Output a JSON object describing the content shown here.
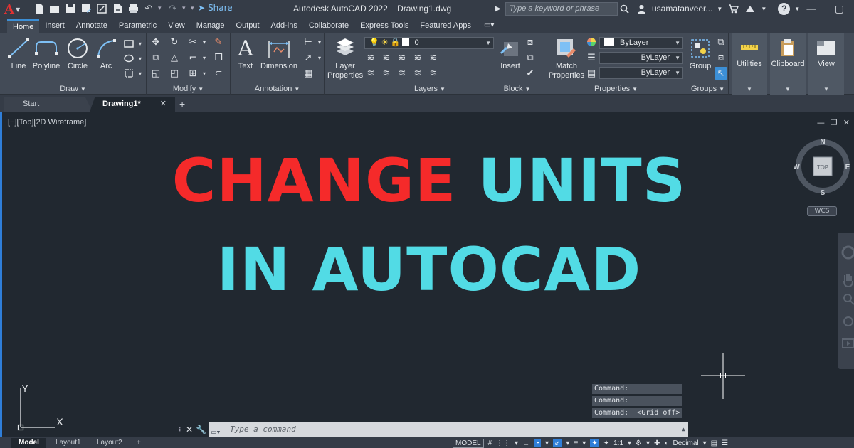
{
  "titlebar": {
    "app_icon": "A",
    "share_label": "Share",
    "title": "Autodesk AutoCAD 2022    Drawing1.dwg",
    "search_placeholder": "Type a keyword or phrase",
    "username": "usamatanveer...",
    "help_label": "?"
  },
  "ribbon_tabs": [
    {
      "label": "Home",
      "active": true
    },
    {
      "label": "Insert"
    },
    {
      "label": "Annotate"
    },
    {
      "label": "Parametric"
    },
    {
      "label": "View"
    },
    {
      "label": "Manage"
    },
    {
      "label": "Output"
    },
    {
      "label": "Add-ins"
    },
    {
      "label": "Collaborate"
    },
    {
      "label": "Express Tools"
    },
    {
      "label": "Featured Apps"
    }
  ],
  "ribbon": {
    "draw": {
      "title": "Draw",
      "line": "Line",
      "polyline": "Polyline",
      "circle": "Circle",
      "arc": "Arc"
    },
    "modify": {
      "title": "Modify"
    },
    "annotation": {
      "title": "Annotation",
      "text": "Text",
      "dimension": "Dimension"
    },
    "layers": {
      "title": "Layers",
      "layer_properties": "Layer\nProperties",
      "current_layer": "0"
    },
    "block": {
      "title": "Block",
      "insert": "Insert"
    },
    "properties": {
      "title": "Properties",
      "match": "Match\nProperties",
      "color": "ByLayer",
      "linetype": "ByLayer",
      "lineweight": "ByLayer"
    },
    "groups": {
      "title": "Groups",
      "group": "Group"
    },
    "utilities": "Utilities",
    "clipboard": "Clipboard",
    "view": "View"
  },
  "file_tabs": {
    "start": "Start",
    "drawing": "Drawing1*"
  },
  "viewport": {
    "label": "[−][Top][2D Wireframe]",
    "headline_word1": "CHANGE",
    "headline_word2": "UNITS",
    "headline_line2": "IN AUTOCAD",
    "colors": {
      "red": "#f52a2a",
      "cyan": "#52dbe5",
      "background": "#212830"
    },
    "viewcube": {
      "n": "N",
      "s": "S",
      "e": "E",
      "w": "W",
      "face": "TOP"
    },
    "wcs": "WCS",
    "ucs": {
      "x": "X",
      "y": "Y"
    }
  },
  "command": {
    "history": [
      "Command:",
      "Command:",
      "Command:  <Grid off>"
    ],
    "placeholder": "Type a command"
  },
  "statusbar": {
    "layouts": [
      "Model",
      "Layout1",
      "Layout2"
    ],
    "model_label": "MODEL",
    "scale": "1:1",
    "units": "Decimal"
  }
}
